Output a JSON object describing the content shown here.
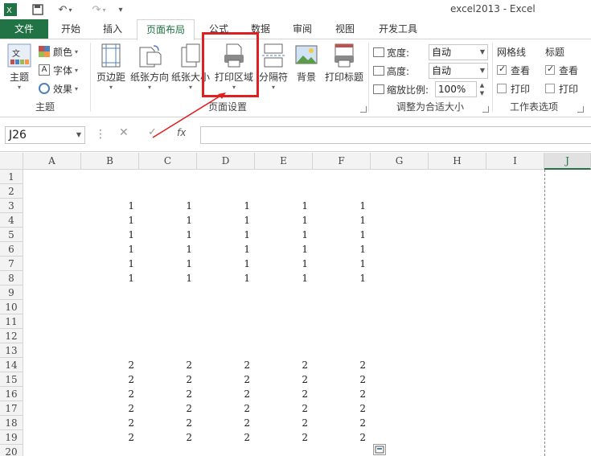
{
  "window": {
    "title": "excel2013 - Excel"
  },
  "tabs": {
    "file": "文件",
    "home": "开始",
    "insert": "插入",
    "page_layout": "页面布局",
    "formulas": "公式",
    "data": "数据",
    "review": "审阅",
    "view": "视图",
    "developer": "开发工具"
  },
  "ribbon": {
    "themes": {
      "themes_btn": "主题",
      "colors": "颜色",
      "fonts": "字体",
      "effects": "效果",
      "label": "主题"
    },
    "page_setup": {
      "margins": "页边距",
      "orientation": "纸张方向",
      "size": "纸张大小",
      "print_area": "打印区域",
      "breaks": "分隔符",
      "background": "背景",
      "print_titles": "打印标题",
      "label": "页面设置"
    },
    "scale_to_fit": {
      "width_label": "宽度:",
      "width_value": "自动",
      "height_label": "高度:",
      "height_value": "自动",
      "scale_label": "缩放比例:",
      "scale_value": "100%",
      "label": "调整为合适大小"
    },
    "sheet_options": {
      "gridlines": "网格线",
      "headings": "标题",
      "view": "查看",
      "print": "打印",
      "label": "工作表选项"
    }
  },
  "formula_bar": {
    "name_box": "J26",
    "fx": "fx",
    "value": ""
  },
  "columns": [
    "A",
    "B",
    "C",
    "D",
    "E",
    "F",
    "G",
    "H",
    "I",
    "J"
  ],
  "rows": [
    "1",
    "2",
    "3",
    "4",
    "5",
    "6",
    "7",
    "8",
    "9",
    "10",
    "11",
    "12",
    "13",
    "14",
    "15",
    "16",
    "17",
    "18",
    "19",
    "20"
  ],
  "cells": {
    "r3": [
      "1",
      "1",
      "1",
      "1",
      "1"
    ],
    "r4": [
      "1",
      "1",
      "1",
      "1",
      "1"
    ],
    "r5": [
      "1",
      "1",
      "1",
      "1",
      "1"
    ],
    "r6": [
      "1",
      "1",
      "1",
      "1",
      "1"
    ],
    "r7": [
      "1",
      "1",
      "1",
      "1",
      "1"
    ],
    "r8": [
      "1",
      "1",
      "1",
      "1",
      "1"
    ],
    "r14": [
      "2",
      "2",
      "2",
      "2",
      "2"
    ],
    "r15": [
      "2",
      "2",
      "2",
      "2",
      "2"
    ],
    "r16": [
      "2",
      "2",
      "2",
      "2",
      "2"
    ],
    "r17": [
      "2",
      "2",
      "2",
      "2",
      "2"
    ],
    "r18": [
      "2",
      "2",
      "2",
      "2",
      "2"
    ],
    "r19": [
      "2",
      "2",
      "2",
      "2",
      "2"
    ]
  },
  "colors": {
    "excel_green": "#217346",
    "highlight_red": "#e02020"
  }
}
